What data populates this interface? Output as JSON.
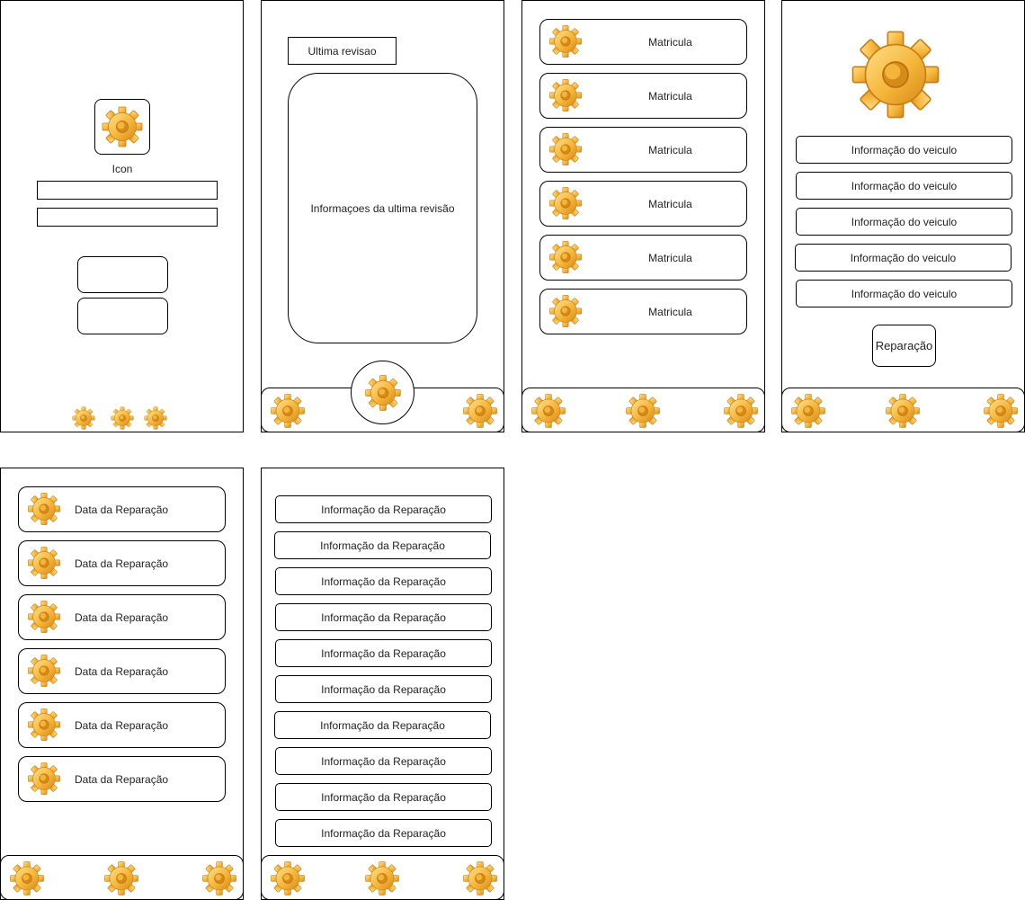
{
  "screen1": {
    "icon_label": "Icon"
  },
  "screen2": {
    "last_review_button": "Ultima revisao",
    "last_review_info": "Informaçoes da ultima revisão"
  },
  "screen3": {
    "items": [
      "Matricula",
      "Matricula",
      "Matricula",
      "Matricula",
      "Matricula",
      "Matricula"
    ]
  },
  "screen4": {
    "items": [
      "Informação do veiculo",
      "Informação do veiculo",
      "Informação do veiculo",
      "Informação do veiculo",
      "Informação do veiculo"
    ],
    "repair_button": "Reparação"
  },
  "screen5": {
    "items": [
      "Data da Reparação",
      "Data da Reparação",
      "Data da Reparação",
      "Data da Reparação",
      "Data da Reparação",
      "Data da Reparação"
    ]
  },
  "screen6": {
    "items": [
      "Informação da Reparação",
      "Informação da Reparação",
      "Informação da Reparação",
      "Informação da Reparação",
      "Informação da Reparação",
      "Informação da Reparação",
      "Informação da Reparação",
      "Informação da Reparação",
      "Informação da Reparação",
      "Informação da Reparação"
    ]
  },
  "icons": {
    "gear": "gear-icon"
  },
  "colors": {
    "gear_light": "#FFD36E",
    "gear_mid": "#F5B53A",
    "gear_dark": "#D68A18"
  }
}
